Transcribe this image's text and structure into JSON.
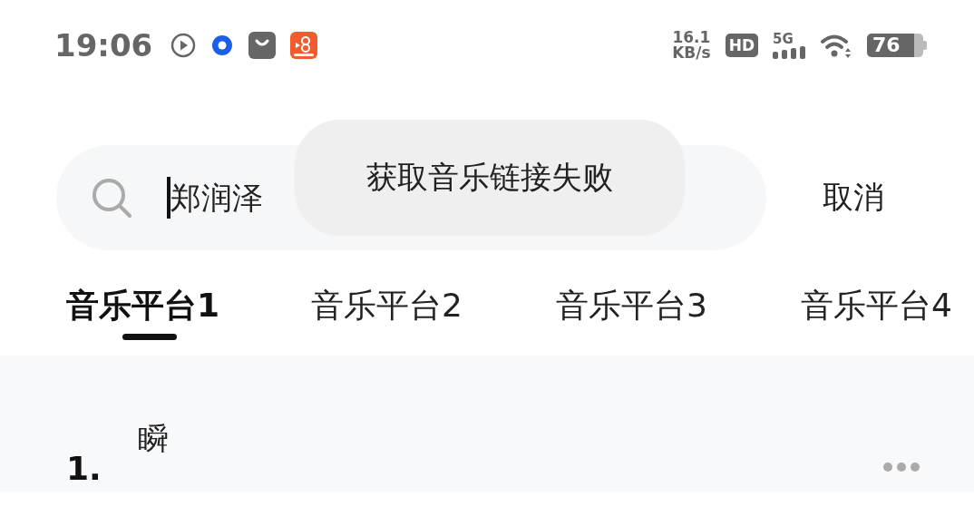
{
  "status_bar": {
    "time": "19:06",
    "speed_value": "16.1",
    "speed_unit": "KB/s",
    "hd": "HD",
    "network": "5G",
    "battery": "76"
  },
  "search": {
    "value": "郑润泽",
    "cancel": "取消"
  },
  "toast": {
    "message": "获取音乐链接失败"
  },
  "tabs": [
    {
      "label": "音乐平台1",
      "selected": true
    },
    {
      "label": "音乐平台2",
      "selected": false
    },
    {
      "label": "音乐平台3",
      "selected": false
    },
    {
      "label": "音乐平台4",
      "selected": false
    }
  ],
  "songs": [
    {
      "number": "1.",
      "title": "瞬"
    }
  ]
}
